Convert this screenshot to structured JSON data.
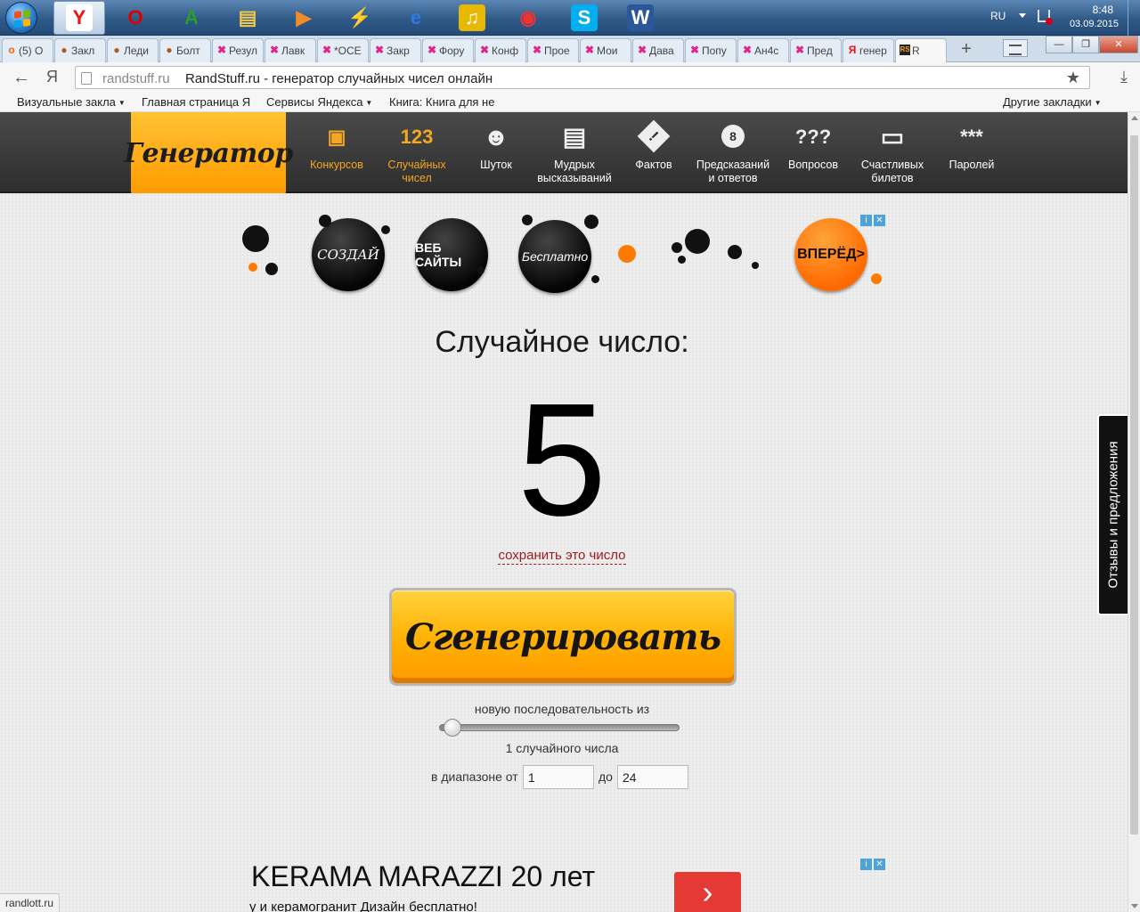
{
  "taskbar": {
    "apps": [
      {
        "name": "yandex-browser",
        "glyph": "Y",
        "color": "#e11",
        "bg": "#fff"
      },
      {
        "name": "opera",
        "glyph": "O",
        "color": "#d00",
        "bg": "transparent"
      },
      {
        "name": "a-app",
        "glyph": "A",
        "color": "#2a9d2a",
        "bg": "transparent"
      },
      {
        "name": "explorer",
        "glyph": "▤",
        "color": "#f2c94c",
        "bg": "transparent"
      },
      {
        "name": "media-player",
        "glyph": "▶",
        "color": "#f28c28",
        "bg": "transparent"
      },
      {
        "name": "winamp",
        "glyph": "⚡",
        "color": "#f2b200",
        "bg": "transparent"
      },
      {
        "name": "internet-explorer",
        "glyph": "e",
        "color": "#2d7be0",
        "bg": "transparent"
      },
      {
        "name": "music",
        "glyph": "♫",
        "color": "#fff",
        "bg": "#e6b800"
      },
      {
        "name": "chrome",
        "glyph": "◉",
        "color": "#e33",
        "bg": "transparent"
      },
      {
        "name": "skype",
        "glyph": "S",
        "color": "#fff",
        "bg": "#00aff0"
      },
      {
        "name": "word",
        "glyph": "W",
        "color": "#fff",
        "bg": "#2b579a"
      }
    ],
    "tray": {
      "lang": "RU",
      "time": "8:48",
      "date": "03.09.2015"
    }
  },
  "tabs": [
    {
      "label": "(5) О",
      "fav": "о",
      "fav_color": "#f60"
    },
    {
      "label": "Закл",
      "fav": "●",
      "fav_color": "#b25a1a"
    },
    {
      "label": "Леди",
      "fav": "●",
      "fav_color": "#b25a1a"
    },
    {
      "label": "Болт",
      "fav": "●",
      "fav_color": "#b25a1a"
    },
    {
      "label": "Резул",
      "fav": "✖",
      "fav_color": "#e0258a"
    },
    {
      "label": "Лавк",
      "fav": "✖",
      "fav_color": "#e0258a"
    },
    {
      "label": "*ОСЕ",
      "fav": "✖",
      "fav_color": "#e0258a"
    },
    {
      "label": "Закр",
      "fav": "✖",
      "fav_color": "#e0258a"
    },
    {
      "label": "Фору",
      "fav": "✖",
      "fav_color": "#e0258a"
    },
    {
      "label": "Конф",
      "fav": "✖",
      "fav_color": "#e0258a"
    },
    {
      "label": "Прое",
      "fav": "✖",
      "fav_color": "#e0258a"
    },
    {
      "label": "Мои",
      "fav": "✖",
      "fav_color": "#e0258a"
    },
    {
      "label": "Дава",
      "fav": "✖",
      "fav_color": "#e0258a"
    },
    {
      "label": "Попу",
      "fav": "✖",
      "fav_color": "#e0258a"
    },
    {
      "label": "Ан4с",
      "fav": "✖",
      "fav_color": "#e0258a"
    },
    {
      "label": "Пред",
      "fav": "✖",
      "fav_color": "#e0258a"
    },
    {
      "label": "генер",
      "fav": "Я",
      "fav_color": "#e11"
    },
    {
      "label": "R",
      "fav": "RS",
      "fav_color": "#f5a623",
      "active": true
    }
  ],
  "address": {
    "host": "randstuff.ru",
    "page_title": "RandStuff.ru - генератор случайных чисел онлайн"
  },
  "bookmarks": {
    "items": [
      "Визуальные закла",
      "Главная страница Я",
      "Сервисы Яндекса",
      "Книга: Книга для не"
    ],
    "other": "Другие закладки"
  },
  "site": {
    "logo": "Генератор",
    "nav": [
      {
        "label": "Конкурсов",
        "icon": "gift-icon",
        "active": true
      },
      {
        "label": "Случайных чисел",
        "icon": "numbers-icon",
        "active": true
      },
      {
        "label": "Шуток",
        "icon": "smile-icon"
      },
      {
        "label": "Мудрых высказываний",
        "icon": "scroll-icon"
      },
      {
        "label": "Фактов",
        "icon": "warning-icon"
      },
      {
        "label": "Предсказаний и ответов",
        "icon": "magic-ball-icon"
      },
      {
        "label": "Вопросов",
        "icon": "question-icon"
      },
      {
        "label": "Счастливых билетов",
        "icon": "ticket-icon"
      },
      {
        "label": "Паролей",
        "icon": "password-icon"
      }
    ]
  },
  "ad_top": {
    "bubbles": [
      "СОЗДАЙ",
      "ВЕБ САЙТЫ",
      "Бесплатно"
    ],
    "cta": "ВПЕРЁД>"
  },
  "generator": {
    "result_label": "Случайное число:",
    "result": "5",
    "save_link": "сохранить это число",
    "button": "Сгенерировать",
    "sequence_label": "новую последовательность из",
    "count_label": "1 случайного числа",
    "range_from_label": "в диапазоне от",
    "range_from": "1",
    "range_to_label": "до",
    "range_to": "24",
    "slider_fraction": 0.03
  },
  "ad_bottom": {
    "title": "KERAMA MARAZZI 20 лет",
    "desc": "у и керамогранит Дизайн бесплатно!",
    "go": "›"
  },
  "feedback_tab": "Отзывы и предложения",
  "status_bar": "randlott.ru"
}
